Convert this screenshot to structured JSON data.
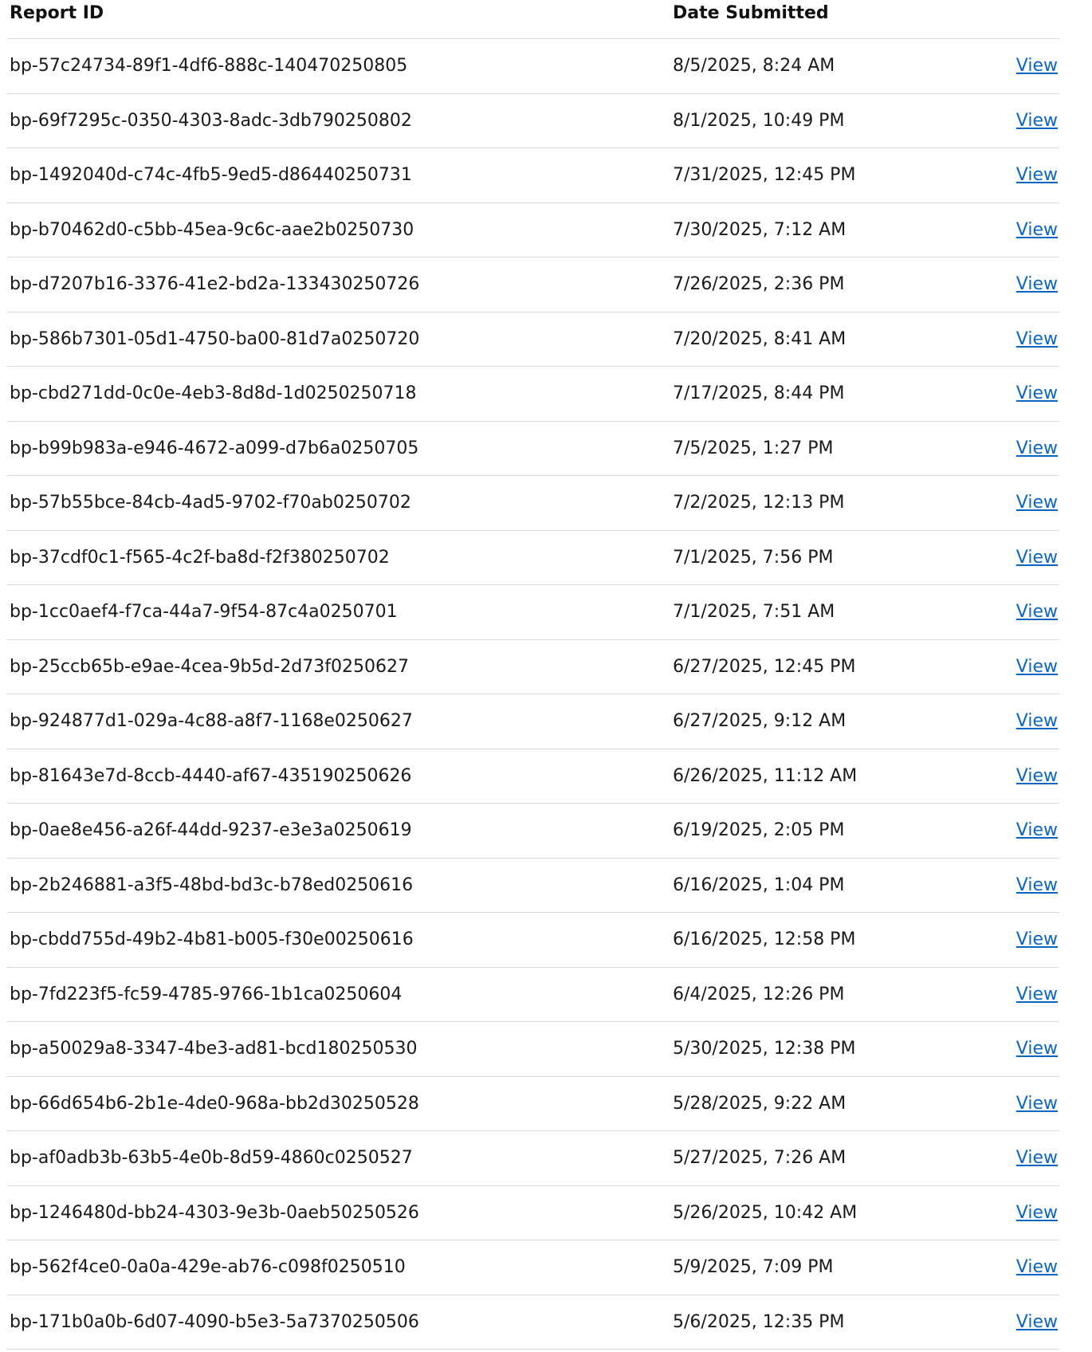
{
  "table": {
    "headers": {
      "report_id": "Report ID",
      "date_submitted": "Date Submitted",
      "action": ""
    },
    "rows": [
      {
        "report_id": "bp-57c24734-89f1-4df6-888c-140470250805",
        "date": "8/5/2025, 8:24 AM",
        "action": "View"
      },
      {
        "report_id": "bp-69f7295c-0350-4303-8adc-3db790250802",
        "date": "8/1/2025, 10:49 PM",
        "action": "View"
      },
      {
        "report_id": "bp-1492040d-c74c-4fb5-9ed5-d86440250731",
        "date": "7/31/2025, 12:45 PM",
        "action": "View"
      },
      {
        "report_id": "bp-b70462d0-c5bb-45ea-9c6c-aae2b0250730",
        "date": "7/30/2025, 7:12 AM",
        "action": "View"
      },
      {
        "report_id": "bp-d7207b16-3376-41e2-bd2a-133430250726",
        "date": "7/26/2025, 2:36 PM",
        "action": "View"
      },
      {
        "report_id": "bp-586b7301-05d1-4750-ba00-81d7a0250720",
        "date": "7/20/2025, 8:41 AM",
        "action": "View"
      },
      {
        "report_id": "bp-cbd271dd-0c0e-4eb3-8d8d-1d0250250718",
        "date": "7/17/2025, 8:44 PM",
        "action": "View"
      },
      {
        "report_id": "bp-b99b983a-e946-4672-a099-d7b6a0250705",
        "date": "7/5/2025, 1:27 PM",
        "action": "View"
      },
      {
        "report_id": "bp-57b55bce-84cb-4ad5-9702-f70ab0250702",
        "date": "7/2/2025, 12:13 PM",
        "action": "View"
      },
      {
        "report_id": "bp-37cdf0c1-f565-4c2f-ba8d-f2f380250702",
        "date": "7/1/2025, 7:56 PM",
        "action": "View"
      },
      {
        "report_id": "bp-1cc0aef4-f7ca-44a7-9f54-87c4a0250701",
        "date": "7/1/2025, 7:51 AM",
        "action": "View"
      },
      {
        "report_id": "bp-25ccb65b-e9ae-4cea-9b5d-2d73f0250627",
        "date": "6/27/2025, 12:45 PM",
        "action": "View"
      },
      {
        "report_id": "bp-924877d1-029a-4c88-a8f7-1168e0250627",
        "date": "6/27/2025, 9:12 AM",
        "action": "View"
      },
      {
        "report_id": "bp-81643e7d-8ccb-4440-af67-435190250626",
        "date": "6/26/2025, 11:12 AM",
        "action": "View"
      },
      {
        "report_id": "bp-0ae8e456-a26f-44dd-9237-e3e3a0250619",
        "date": "6/19/2025, 2:05 PM",
        "action": "View"
      },
      {
        "report_id": "bp-2b246881-a3f5-48bd-bd3c-b78ed0250616",
        "date": "6/16/2025, 1:04 PM",
        "action": "View"
      },
      {
        "report_id": "bp-cbdd755d-49b2-4b81-b005-f30e00250616",
        "date": "6/16/2025, 12:58 PM",
        "action": "View"
      },
      {
        "report_id": "bp-7fd223f5-fc59-4785-9766-1b1ca0250604",
        "date": "6/4/2025, 12:26 PM",
        "action": "View"
      },
      {
        "report_id": "bp-a50029a8-3347-4be3-ad81-bcd180250530",
        "date": "5/30/2025, 12:38 PM",
        "action": "View"
      },
      {
        "report_id": "bp-66d654b6-2b1e-4de0-968a-bb2d30250528",
        "date": "5/28/2025, 9:22 AM",
        "action": "View"
      },
      {
        "report_id": "bp-af0adb3b-63b5-4e0b-8d59-4860c0250527",
        "date": "5/27/2025, 7:26 AM",
        "action": "View"
      },
      {
        "report_id": "bp-1246480d-bb24-4303-9e3b-0aeb50250526",
        "date": "5/26/2025, 10:42 AM",
        "action": "View"
      },
      {
        "report_id": "bp-562f4ce0-0a0a-429e-ab76-c098f0250510",
        "date": "5/9/2025, 7:09 PM",
        "action": "View"
      },
      {
        "report_id": "bp-171b0a0b-6d07-4090-b5e3-5a7370250506",
        "date": "5/6/2025, 12:35 PM",
        "action": "View"
      }
    ]
  },
  "colors": {
    "link": "#0b66c3",
    "divider": "#d8d8d8",
    "text": "#1a1a1a"
  }
}
